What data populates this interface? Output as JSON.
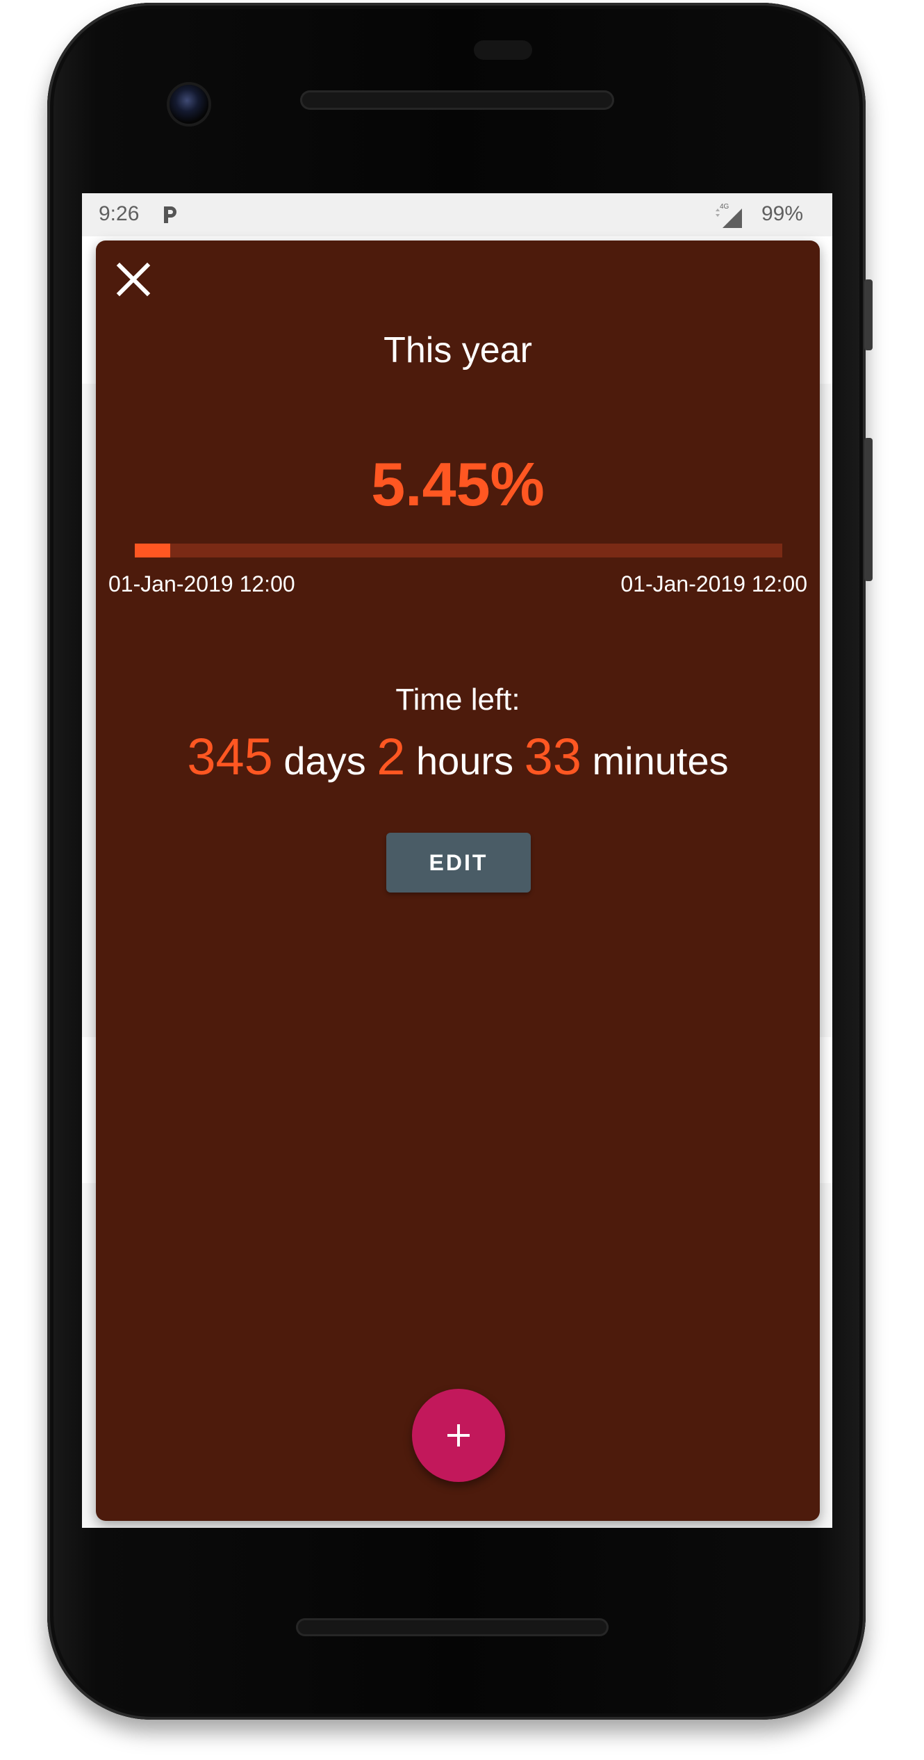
{
  "status_bar": {
    "time": "9:26",
    "network": "4G",
    "battery": "99%",
    "notification_icon": "parking-icon"
  },
  "card": {
    "title": "This year",
    "percent_text": "5.45%",
    "progress_fraction": 0.0545,
    "start_date": "01-Jan-2019 12:00",
    "end_date": "01-Jan-2019 12:00",
    "time_left_label": "Time left:",
    "time_left": {
      "days": "345",
      "days_unit": "days",
      "hours": "2",
      "hours_unit": "hours",
      "minutes": "33",
      "minutes_unit": "minutes"
    },
    "edit_label": "EDIT",
    "close_icon": "close-icon"
  },
  "fab": {
    "label": "+",
    "icon": "plus-icon"
  },
  "colors": {
    "card_background": "#4d1b0c",
    "accent": "#ff5722",
    "progress_track": "#7a2a15",
    "edit_button": "#4a5c66",
    "fab": "#c2185b"
  }
}
